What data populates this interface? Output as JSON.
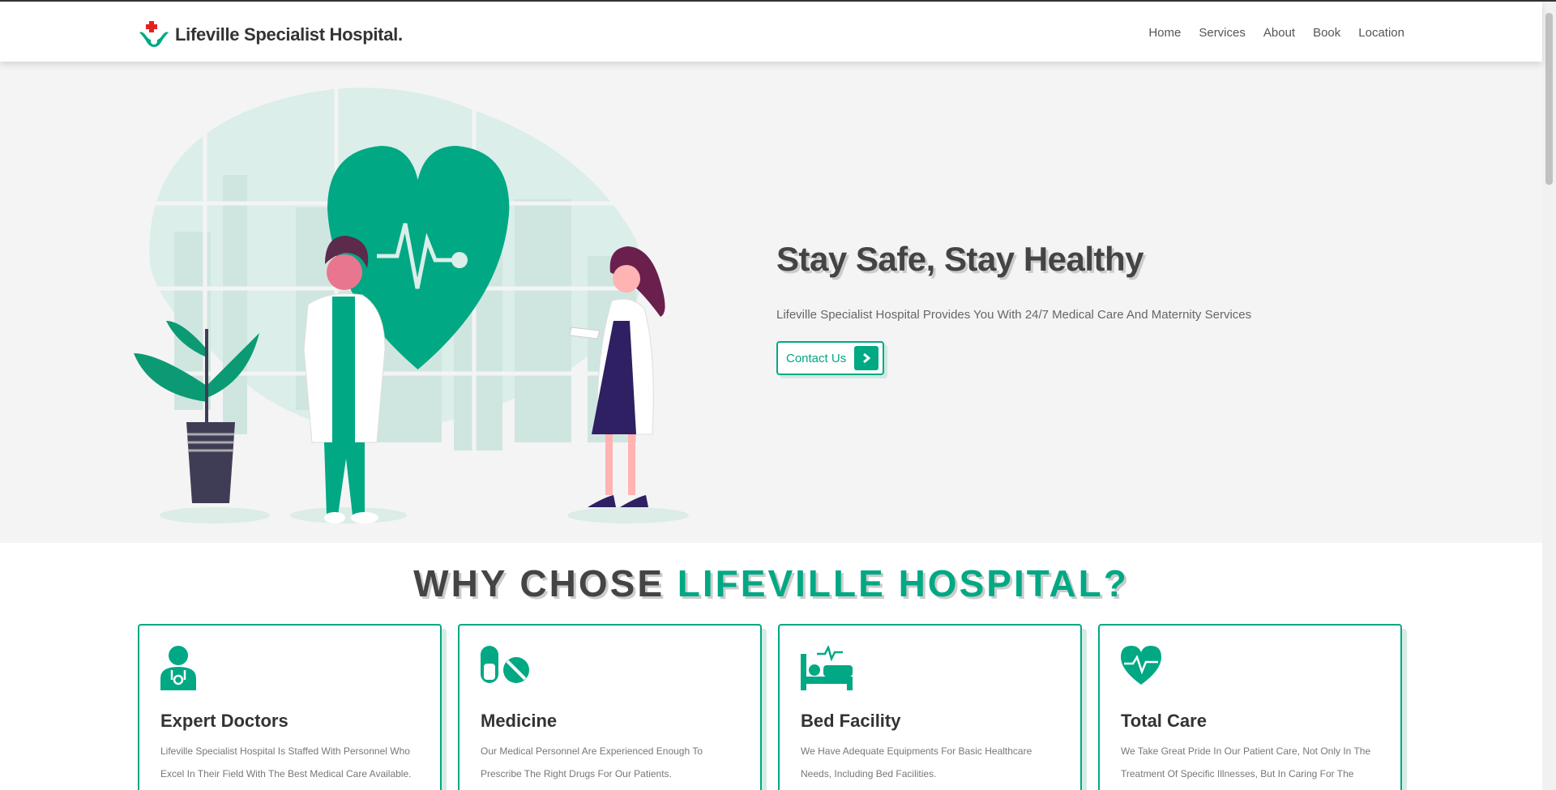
{
  "header": {
    "brand": "Lifeville Specialist Hospital.",
    "nav": [
      "Home",
      "Services",
      "About",
      "Book",
      "Location"
    ]
  },
  "hero": {
    "title": "Stay Safe, Stay Healthy",
    "subtitle": "Lifeville Specialist Hospital Provides You With 24/7 Medical Care And Maternity Services",
    "cta_label": "Contact Us"
  },
  "why": {
    "title_part1": "WHY CHOSE",
    "title_part2": "LIFEVILLE HOSPITAL?",
    "cards": [
      {
        "icon": "doctor-icon",
        "title": "Expert Doctors",
        "text": "Lifeville Specialist Hospital Is Staffed With Personnel Who Excel In Their Field With The Best Medical Care Available."
      },
      {
        "icon": "pills-icon",
        "title": "Medicine",
        "text": "Our Medical Personnel Are Experienced Enough To Prescribe The Right Drugs For Our Patients."
      },
      {
        "icon": "bed-icon",
        "title": "Bed Facility",
        "text": "We Have Adequate Equipments For Basic Healthcare Needs, Including Bed Facilities."
      },
      {
        "icon": "heartbeat-icon",
        "title": "Total Care",
        "text": "We Take Great Pride In Our Patient Care, Not Only In The Treatment Of Specific Illnesses, But In Caring For The Whole Patient Through A Multidisciplinary Approach."
      }
    ]
  },
  "colors": {
    "accent": "#00a884",
    "heading": "#444444",
    "hero_bg": "#f4f4f4"
  }
}
